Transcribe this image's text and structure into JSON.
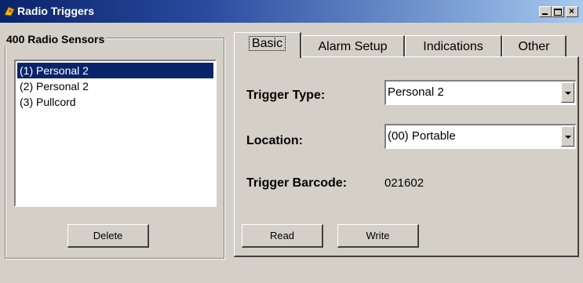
{
  "window": {
    "title": "Radio Triggers",
    "controls": {
      "minimize": "_",
      "maximize": "□",
      "close": "×"
    }
  },
  "sensors": {
    "group_label": "400 Radio Sensors",
    "items": [
      {
        "label": "(1) Personal 2",
        "selected": true
      },
      {
        "label": "(2) Personal 2",
        "selected": false
      },
      {
        "label": "(3) Pullcord",
        "selected": false
      }
    ],
    "delete_label": "Delete"
  },
  "tabs": [
    {
      "label": "Basic",
      "active": true
    },
    {
      "label": "Alarm Setup",
      "active": false
    },
    {
      "label": "Indications",
      "active": false
    },
    {
      "label": "Other",
      "active": false
    }
  ],
  "basic": {
    "trigger_type_label": "Trigger Type:",
    "trigger_type_value": "Personal 2",
    "location_label": "Location:",
    "location_value": "(00) Portable",
    "barcode_label": "Trigger Barcode:",
    "barcode_value": "021602",
    "read_label": "Read",
    "write_label": "Write"
  },
  "colors": {
    "face": "#d4d0c8",
    "title_start": "#0a246a",
    "title_end": "#a6caf0",
    "selection": "#0a246a"
  }
}
